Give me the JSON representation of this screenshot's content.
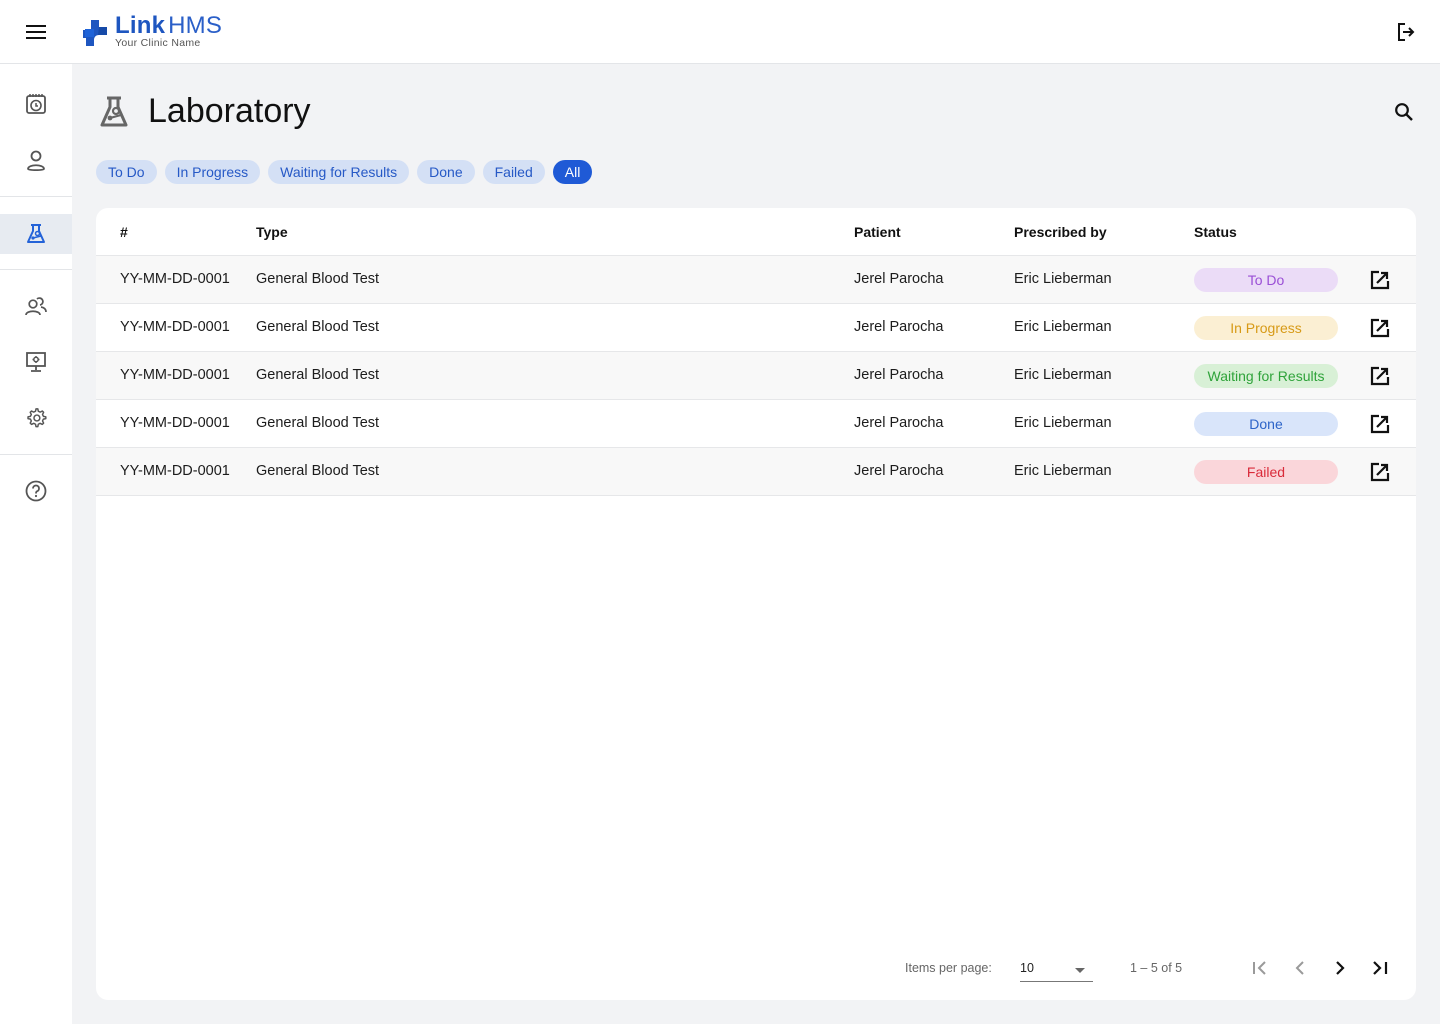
{
  "app": {
    "brand_bold": "Link",
    "brand_rest": "HMS",
    "subtitle": "Your Clinic Name",
    "icons": {
      "menu": "hamburger-icon",
      "logout": "logout-icon"
    }
  },
  "sidebar": {
    "items": [
      {
        "id": "appointments",
        "icon": "calendar-clock-icon",
        "active": false
      },
      {
        "id": "patients",
        "icon": "person-icon",
        "active": false
      },
      {
        "id": "laboratory",
        "icon": "flask-icon",
        "active": true
      },
      {
        "id": "staff",
        "icon": "people-icon",
        "active": false
      },
      {
        "id": "display",
        "icon": "monitor-settings-icon",
        "active": false
      },
      {
        "id": "settings",
        "icon": "gear-icon",
        "active": false
      },
      {
        "id": "help",
        "icon": "help-circle-icon",
        "active": false
      }
    ]
  },
  "page": {
    "title": "Laboratory",
    "icon": "flask-icon",
    "search_icon": "search-icon"
  },
  "filters": [
    {
      "label": "To Do",
      "active": false
    },
    {
      "label": "In Progress",
      "active": false
    },
    {
      "label": "Waiting for Results",
      "active": false
    },
    {
      "label": "Done",
      "active": false
    },
    {
      "label": "Failed",
      "active": false
    },
    {
      "label": "All",
      "active": true
    }
  ],
  "table": {
    "columns": [
      "#",
      "Type",
      "Patient",
      "Prescribed by",
      "Status"
    ],
    "rows": [
      {
        "id": "YY-MM-DD-0001",
        "type": "General Blood Test",
        "patient": "Jerel Parocha",
        "prescribed_by": "Eric Lieberman",
        "status": "To Do"
      },
      {
        "id": "YY-MM-DD-0001",
        "type": "General Blood Test",
        "patient": "Jerel Parocha",
        "prescribed_by": "Eric Lieberman",
        "status": "In Progress"
      },
      {
        "id": "YY-MM-DD-0001",
        "type": "General Blood Test",
        "patient": "Jerel Parocha",
        "prescribed_by": "Eric Lieberman",
        "status": "Waiting for Results"
      },
      {
        "id": "YY-MM-DD-0001",
        "type": "General Blood Test",
        "patient": "Jerel Parocha",
        "prescribed_by": "Eric Lieberman",
        "status": "Done"
      },
      {
        "id": "YY-MM-DD-0001",
        "type": "General Blood Test",
        "patient": "Jerel Parocha",
        "prescribed_by": "Eric Lieberman",
        "status": "Failed"
      }
    ],
    "row_action_icon": "open-in-new-icon"
  },
  "status_colors": {
    "To Do": {
      "bg": "#ebdcf7",
      "fg": "#9a4fd6"
    },
    "In Progress": {
      "bg": "#fbefd3",
      "fg": "#d79a17"
    },
    "Waiting for Results": {
      "bg": "#d8f0d6",
      "fg": "#2fa33a"
    },
    "Done": {
      "bg": "#d9e5fa",
      "fg": "#2d64c8"
    },
    "Failed": {
      "bg": "#fad6da",
      "fg": "#d92b3a"
    }
  },
  "paginator": {
    "items_per_page_label": "Items per page:",
    "items_per_page": "10",
    "range": "1 – 5 of 5",
    "first_enabled": false,
    "prev_enabled": false,
    "next_enabled": true,
    "last_enabled": true
  },
  "colors": {
    "accent": "#1f5ad6",
    "chip_bg": "#d4e0f5",
    "chip_fg": "#2659c6"
  }
}
